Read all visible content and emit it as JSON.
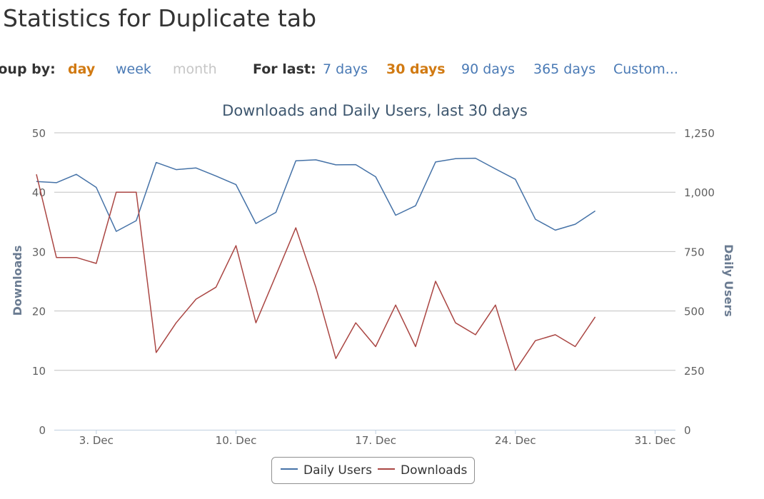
{
  "page": {
    "title": "Statistics for Duplicate tab"
  },
  "controls": {
    "group_by_label": "roup by:",
    "group_by_options": [
      {
        "label": "day",
        "state": "active"
      },
      {
        "label": "week",
        "state": "link"
      },
      {
        "label": "month",
        "state": "disabled"
      }
    ],
    "for_last_label": "For last:",
    "for_last_options": [
      {
        "label": "7 days",
        "state": "link"
      },
      {
        "label": "30 days",
        "state": "active"
      },
      {
        "label": "90 days",
        "state": "link"
      },
      {
        "label": "365 days",
        "state": "link"
      },
      {
        "label": "Custom...",
        "state": "link"
      }
    ]
  },
  "colors": {
    "daily_users": "#4572a7",
    "downloads": "#aa4643",
    "active": "#d17a12",
    "link": "#4a7ab5",
    "disabled": "#c6c6c6",
    "axis_title": "#6a7b91",
    "grid": "#c0c0c0"
  },
  "chart_data": {
    "type": "line",
    "title": "Downloads and Daily Users, last 30 days",
    "x_dates": [
      "Nov 30",
      "Dec 1",
      "Dec 2",
      "Dec 3",
      "Dec 4",
      "Dec 5",
      "Dec 6",
      "Dec 7",
      "Dec 8",
      "Dec 9",
      "Dec 10",
      "Dec 11",
      "Dec 12",
      "Dec 13",
      "Dec 14",
      "Dec 15",
      "Dec 16",
      "Dec 17",
      "Dec 18",
      "Dec 19",
      "Dec 20",
      "Dec 21",
      "Dec 22",
      "Dec 23",
      "Dec 24",
      "Dec 25",
      "Dec 26",
      "Dec 27",
      "Dec 28",
      "Dec 29"
    ],
    "x_ticks": [
      "3. Dec",
      "10. Dec",
      "17. Dec",
      "24. Dec",
      "31. Dec"
    ],
    "x_range": [
      "Nov 30",
      "Dec 31"
    ],
    "y_left": {
      "title": "Downloads",
      "range": [
        0,
        50
      ],
      "ticks": [
        "0",
        "10",
        "20",
        "30",
        "40",
        "50"
      ]
    },
    "y_right": {
      "title": "Daily Users",
      "range": [
        0,
        1250
      ],
      "ticks": [
        "0",
        "250",
        "500",
        "750",
        "1,000",
        "1,250"
      ]
    },
    "grid": true,
    "legend_position": "bottom-center",
    "series": [
      {
        "name": "Daily Users",
        "axis": "right",
        "values": [
          1045,
          1040,
          1075,
          1020,
          835,
          880,
          1125,
          1095,
          1102,
          1068,
          1032,
          868,
          915,
          1132,
          1136,
          1115,
          1116,
          1065,
          903,
          943,
          1127,
          1141,
          1143,
          1098,
          1054,
          886,
          840,
          865,
          921,
          null
        ]
      },
      {
        "name": "Downloads",
        "axis": "left",
        "values": [
          43,
          29,
          29,
          28,
          40,
          40,
          13,
          18,
          22,
          24,
          31,
          18,
          26,
          34,
          24,
          12,
          18,
          14,
          21,
          14,
          25,
          18,
          16,
          21,
          10,
          15,
          16,
          14,
          19,
          null
        ]
      }
    ]
  }
}
